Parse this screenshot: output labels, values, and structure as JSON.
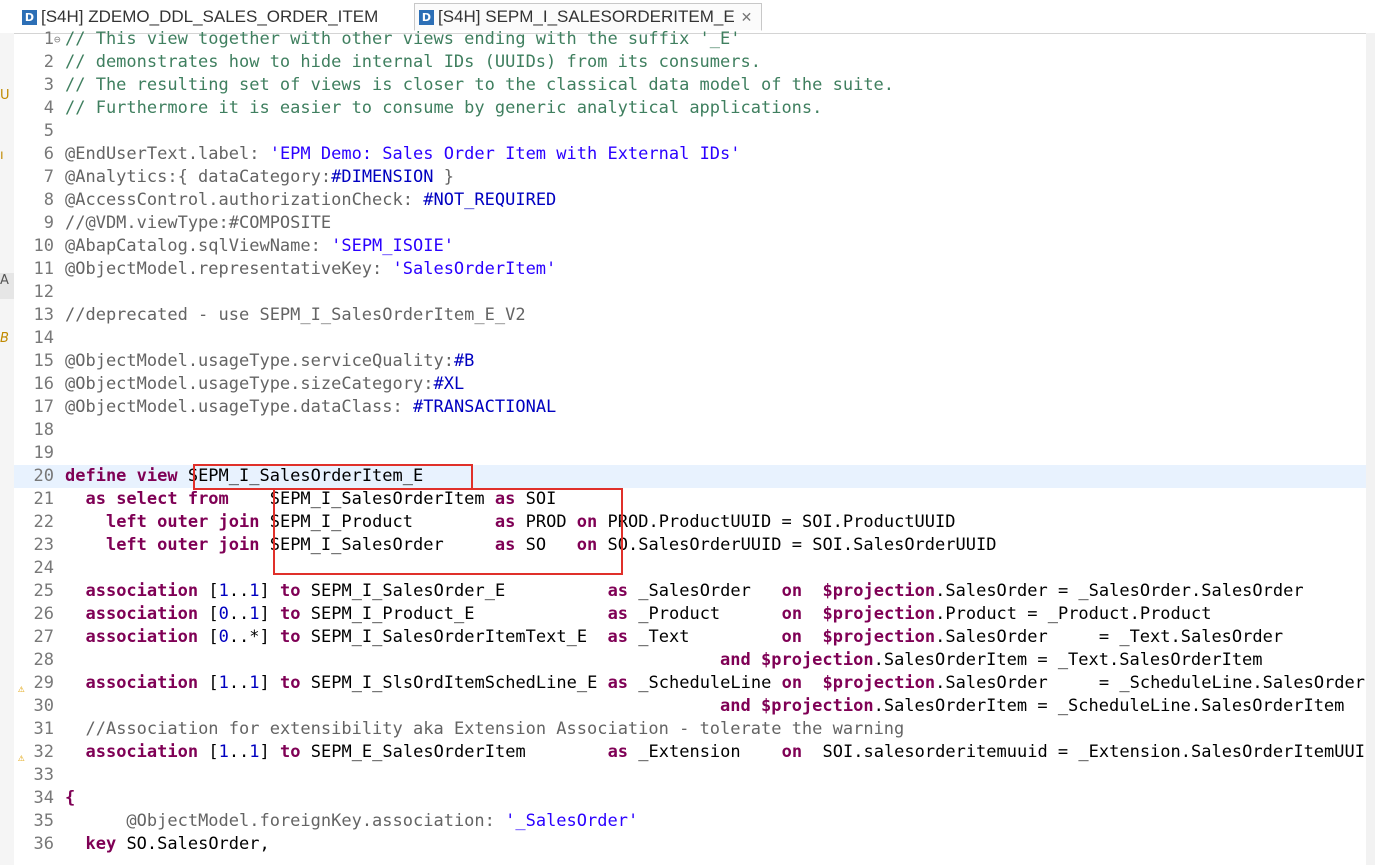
{
  "tabs": [
    {
      "icon": "D",
      "label": "[S4H] ZDEMO_DDL_SALES_ORDER_ITEM",
      "active": false
    },
    {
      "icon": "D",
      "label": "[S4H] SEPM_I_SALESORDERITEM_E",
      "active": true,
      "close": "✕"
    }
  ],
  "gutter_marks": [
    {
      "text": "U",
      "sel": false
    },
    {
      "text": "ı",
      "sel": false
    },
    {
      "text": "A",
      "sel": true
    },
    {
      "text": "B",
      "sel": false
    }
  ],
  "colors": {
    "comment": "#3f7f5f",
    "annotation": "#646464",
    "keyword": "#7f0055",
    "string": "#2a00ff",
    "constant": "#0000c0",
    "highlight_box": "#e0302a",
    "current_line": "#e8f2fe"
  },
  "code_lines": [
    {
      "n": "1",
      "html": "<span class='cm'>// This view together with other views ending with the suffix '_E'</span>",
      "fold": "⊖"
    },
    {
      "n": "2",
      "html": "<span class='cm'>// demonstrates how to hide internal IDs (UUIDs) from its consumers.</span>"
    },
    {
      "n": "3",
      "html": "<span class='cm'>// The resulting set of views is closer to the classical data model of the suite.</span>"
    },
    {
      "n": "4",
      "html": "<span class='cm'>// Furthermore it is easier to consume by generic analytical applications.</span>"
    },
    {
      "n": "5",
      "html": ""
    },
    {
      "n": "6",
      "html": "<span class='an'>@EndUserText.label: </span><span class='st'>'EPM Demo: Sales Order Item with External IDs'</span>"
    },
    {
      "n": "7",
      "html": "<span class='an'>@Analytics:{ dataCategory:</span><span class='cs'>#DIMENSION</span><span class='an'> }</span>"
    },
    {
      "n": "8",
      "html": "<span class='an'>@AccessControl.authorizationCheck: </span><span class='cs'>#NOT_REQUIRED</span>"
    },
    {
      "n": "9",
      "html": "<span class='an'>//@VDM.viewType:#COMPOSITE</span>"
    },
    {
      "n": "10",
      "html": "<span class='an'>@AbapCatalog.sqlViewName: </span><span class='st'>'SEPM_ISOIE'</span>"
    },
    {
      "n": "11",
      "html": "<span class='an'>@ObjectModel.representativeKey: </span><span class='st'>'SalesOrderItem'</span>"
    },
    {
      "n": "12",
      "html": ""
    },
    {
      "n": "13",
      "html": "<span class='an'>//deprecated - use SEPM_I_SalesOrderItem_E_V2</span>"
    },
    {
      "n": "14",
      "html": ""
    },
    {
      "n": "15",
      "html": "<span class='an'>@ObjectModel.usageType.serviceQuality:</span><span class='cs'>#B</span>"
    },
    {
      "n": "16",
      "html": "<span class='an'>@ObjectModel.usageType.sizeCategory:</span><span class='cs'>#XL</span>"
    },
    {
      "n": "17",
      "html": "<span class='an'>@ObjectModel.usageType.dataClass: </span><span class='cs'>#TRANSACTIONAL</span>"
    },
    {
      "n": "18",
      "html": ""
    },
    {
      "n": "19",
      "html": ""
    },
    {
      "n": "20",
      "html": "<span class='kw'>define view</span> SEPM_I_SalesOrderItem_E",
      "cur": true
    },
    {
      "n": "21",
      "html": "  <span class='kw'>as select from</span>    SEPM_I_SalesOrderItem <span class='kw'>as</span> SOI"
    },
    {
      "n": "22",
      "html": "    <span class='kw'>left outer join</span> SEPM_I_Product        <span class='kw'>as</span> PROD <span class='kw'>on</span> PROD.ProductUUID = SOI.ProductUUID"
    },
    {
      "n": "23",
      "html": "    <span class='kw'>left outer join</span> SEPM_I_SalesOrder     <span class='kw'>as</span> SO   <span class='kw'>on</span> SO.SalesOrderUUID = SOI.SalesOrderUUID"
    },
    {
      "n": "24",
      "html": ""
    },
    {
      "n": "25",
      "html": "  <span class='kw'>association</span> [<span class='cs'>1</span>..<span class='cs'>1</span>] <span class='kw'>to</span> SEPM_I_SalesOrder_E          <span class='kw'>as</span> _SalesOrder   <span class='kw'>on</span>  <span class='kw'>$projection</span>.SalesOrder = _SalesOrder.SalesOrder"
    },
    {
      "n": "26",
      "html": "  <span class='kw'>association</span> [<span class='cs'>0</span>..<span class='cs'>1</span>] <span class='kw'>to</span> SEPM_I_Product_E             <span class='kw'>as</span> _Product      <span class='kw'>on</span>  <span class='kw'>$projection</span>.Product = _Product.Product"
    },
    {
      "n": "27",
      "html": "  <span class='kw'>association</span> [<span class='cs'>0</span>..*] <span class='kw'>to</span> SEPM_I_SalesOrderItemText_E  <span class='kw'>as</span> _Text         <span class='kw'>on</span>  <span class='kw'>$projection</span>.SalesOrder     = _Text.SalesOrder"
    },
    {
      "n": "28",
      "html": "                                                                <span class='kw'>and</span> <span class='kw'>$projection</span>.SalesOrderItem = _Text.SalesOrderItem"
    },
    {
      "n": "29",
      "html": "  <span class='kw'>association</span> [<span class='cs'>1</span>..<span class='cs'>1</span>] <span class='kw'>to</span> SEPM_I_SlsOrdItemSchedLine_E <span class='kw'>as</span> _ScheduleLine <span class='kw'>on</span>  <span class='kw'>$projection</span>.SalesOrder     = _ScheduleLine.SalesOrder",
      "warn": "⚠"
    },
    {
      "n": "30",
      "html": "                                                                <span class='kw'>and</span> <span class='kw'>$projection</span>.SalesOrderItem = _ScheduleLine.SalesOrderItem"
    },
    {
      "n": "31",
      "html": "  <span class='an'>//Association for extensibility aka Extension Association - tolerate the warning</span>"
    },
    {
      "n": "32",
      "html": "  <span class='kw'>association</span> [<span class='cs'>1</span>..<span class='cs'>1</span>] <span class='kw'>to</span> SEPM_E_SalesOrderItem        <span class='kw'>as</span> _Extension    <span class='kw'>on</span>  SOI.salesorderitemuuid = _Extension.SalesOrderItemUUID",
      "warn": "⚠"
    },
    {
      "n": "33",
      "html": ""
    },
    {
      "n": "34",
      "html": "<span class='kw'>{</span>"
    },
    {
      "n": "35",
      "html": "      <span class='an'>@ObjectModel.foreignKey.association: </span><span class='st'>'_SalesOrder'</span>"
    },
    {
      "n": "36",
      "html": "  <span class='kw'>key</span> SO.SalesOrder,"
    }
  ]
}
